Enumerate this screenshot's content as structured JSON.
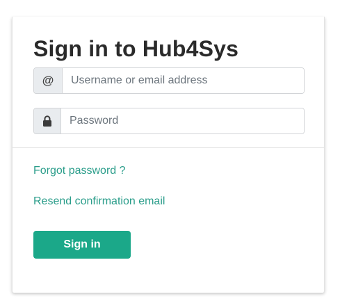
{
  "form": {
    "title": "Sign in to Hub4Sys",
    "username": {
      "icon": "at-sign-icon",
      "icon_glyph": "@",
      "placeholder": "Username or email address",
      "value": ""
    },
    "password": {
      "icon": "lock-icon",
      "placeholder": "Password",
      "value": ""
    },
    "forgot_password_label": "Forgot password ?",
    "resend_confirmation_label": "Resend confirmation email",
    "sign_in_label": "Sign in"
  },
  "colors": {
    "accent": "#1ba889",
    "link": "#2a9d8a",
    "addon_bg": "#e9ecef"
  }
}
